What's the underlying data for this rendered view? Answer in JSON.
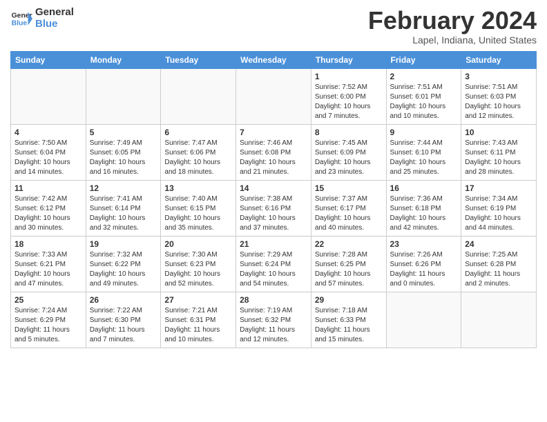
{
  "logo": {
    "line1": "General",
    "line2": "Blue"
  },
  "title": "February 2024",
  "subtitle": "Lapel, Indiana, United States",
  "days_of_week": [
    "Sunday",
    "Monday",
    "Tuesday",
    "Wednesday",
    "Thursday",
    "Friday",
    "Saturday"
  ],
  "weeks": [
    [
      {
        "num": "",
        "info": ""
      },
      {
        "num": "",
        "info": ""
      },
      {
        "num": "",
        "info": ""
      },
      {
        "num": "",
        "info": ""
      },
      {
        "num": "1",
        "info": "Sunrise: 7:52 AM\nSunset: 6:00 PM\nDaylight: 10 hours and 7 minutes."
      },
      {
        "num": "2",
        "info": "Sunrise: 7:51 AM\nSunset: 6:01 PM\nDaylight: 10 hours and 10 minutes."
      },
      {
        "num": "3",
        "info": "Sunrise: 7:51 AM\nSunset: 6:03 PM\nDaylight: 10 hours and 12 minutes."
      }
    ],
    [
      {
        "num": "4",
        "info": "Sunrise: 7:50 AM\nSunset: 6:04 PM\nDaylight: 10 hours and 14 minutes."
      },
      {
        "num": "5",
        "info": "Sunrise: 7:49 AM\nSunset: 6:05 PM\nDaylight: 10 hours and 16 minutes."
      },
      {
        "num": "6",
        "info": "Sunrise: 7:47 AM\nSunset: 6:06 PM\nDaylight: 10 hours and 18 minutes."
      },
      {
        "num": "7",
        "info": "Sunrise: 7:46 AM\nSunset: 6:08 PM\nDaylight: 10 hours and 21 minutes."
      },
      {
        "num": "8",
        "info": "Sunrise: 7:45 AM\nSunset: 6:09 PM\nDaylight: 10 hours and 23 minutes."
      },
      {
        "num": "9",
        "info": "Sunrise: 7:44 AM\nSunset: 6:10 PM\nDaylight: 10 hours and 25 minutes."
      },
      {
        "num": "10",
        "info": "Sunrise: 7:43 AM\nSunset: 6:11 PM\nDaylight: 10 hours and 28 minutes."
      }
    ],
    [
      {
        "num": "11",
        "info": "Sunrise: 7:42 AM\nSunset: 6:12 PM\nDaylight: 10 hours and 30 minutes."
      },
      {
        "num": "12",
        "info": "Sunrise: 7:41 AM\nSunset: 6:14 PM\nDaylight: 10 hours and 32 minutes."
      },
      {
        "num": "13",
        "info": "Sunrise: 7:40 AM\nSunset: 6:15 PM\nDaylight: 10 hours and 35 minutes."
      },
      {
        "num": "14",
        "info": "Sunrise: 7:38 AM\nSunset: 6:16 PM\nDaylight: 10 hours and 37 minutes."
      },
      {
        "num": "15",
        "info": "Sunrise: 7:37 AM\nSunset: 6:17 PM\nDaylight: 10 hours and 40 minutes."
      },
      {
        "num": "16",
        "info": "Sunrise: 7:36 AM\nSunset: 6:18 PM\nDaylight: 10 hours and 42 minutes."
      },
      {
        "num": "17",
        "info": "Sunrise: 7:34 AM\nSunset: 6:19 PM\nDaylight: 10 hours and 44 minutes."
      }
    ],
    [
      {
        "num": "18",
        "info": "Sunrise: 7:33 AM\nSunset: 6:21 PM\nDaylight: 10 hours and 47 minutes."
      },
      {
        "num": "19",
        "info": "Sunrise: 7:32 AM\nSunset: 6:22 PM\nDaylight: 10 hours and 49 minutes."
      },
      {
        "num": "20",
        "info": "Sunrise: 7:30 AM\nSunset: 6:23 PM\nDaylight: 10 hours and 52 minutes."
      },
      {
        "num": "21",
        "info": "Sunrise: 7:29 AM\nSunset: 6:24 PM\nDaylight: 10 hours and 54 minutes."
      },
      {
        "num": "22",
        "info": "Sunrise: 7:28 AM\nSunset: 6:25 PM\nDaylight: 10 hours and 57 minutes."
      },
      {
        "num": "23",
        "info": "Sunrise: 7:26 AM\nSunset: 6:26 PM\nDaylight: 11 hours and 0 minutes."
      },
      {
        "num": "24",
        "info": "Sunrise: 7:25 AM\nSunset: 6:28 PM\nDaylight: 11 hours and 2 minutes."
      }
    ],
    [
      {
        "num": "25",
        "info": "Sunrise: 7:24 AM\nSunset: 6:29 PM\nDaylight: 11 hours and 5 minutes."
      },
      {
        "num": "26",
        "info": "Sunrise: 7:22 AM\nSunset: 6:30 PM\nDaylight: 11 hours and 7 minutes."
      },
      {
        "num": "27",
        "info": "Sunrise: 7:21 AM\nSunset: 6:31 PM\nDaylight: 11 hours and 10 minutes."
      },
      {
        "num": "28",
        "info": "Sunrise: 7:19 AM\nSunset: 6:32 PM\nDaylight: 11 hours and 12 minutes."
      },
      {
        "num": "29",
        "info": "Sunrise: 7:18 AM\nSunset: 6:33 PM\nDaylight: 11 hours and 15 minutes."
      },
      {
        "num": "",
        "info": ""
      },
      {
        "num": "",
        "info": ""
      }
    ]
  ]
}
